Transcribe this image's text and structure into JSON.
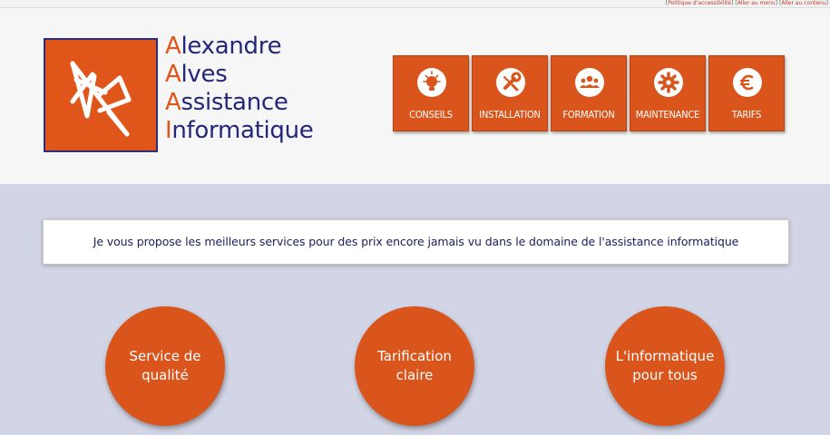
{
  "accessibility_bar": {
    "links": [
      "Politique d'accessibilité",
      "Aller au menu",
      "Aller au contenu"
    ]
  },
  "brand": {
    "lines": [
      {
        "initial": "A",
        "rest": "lexandre"
      },
      {
        "initial": "A",
        "rest": "lves"
      },
      {
        "initial": "A",
        "rest": "ssistance"
      },
      {
        "initial": "I",
        "rest": "nformatique"
      }
    ]
  },
  "logo": {
    "icon": "ladder-logo-icon"
  },
  "nav": {
    "items": [
      {
        "label": "CONSEILS",
        "icon": "lightbulb-icon"
      },
      {
        "label": "INSTALLATION",
        "icon": "wrench-icon"
      },
      {
        "label": "FORMATION",
        "icon": "group-icon"
      },
      {
        "label": "MAINTENANCE",
        "icon": "gear-icon"
      },
      {
        "label": "TARIFS",
        "icon": "euro-icon"
      }
    ]
  },
  "tagline": "Je vous propose les meilleurs services pour des prix encore jamais vu dans le domaine de l'assistance informatique",
  "features": [
    {
      "line1": "Service de",
      "line2": "qualité"
    },
    {
      "line1": "Tarification",
      "line2": "claire"
    },
    {
      "line1": "L'informatique",
      "line2": "pour tous"
    }
  ],
  "colors": {
    "accent_orange": "#d9551c",
    "brand_navy": "#23277a",
    "content_background": "#d2d5e5"
  }
}
